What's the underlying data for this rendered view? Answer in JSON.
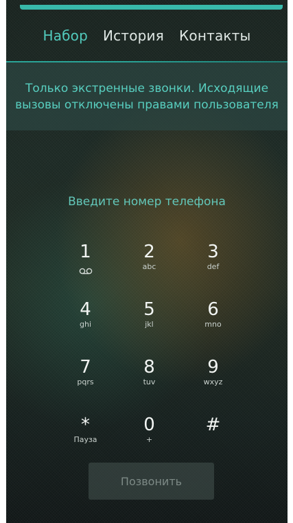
{
  "tabs": [
    {
      "label": "Набор",
      "active": true
    },
    {
      "label": "История",
      "active": false
    },
    {
      "label": "Контакты",
      "active": false
    }
  ],
  "notice": "Только экстренные звонки. Исходящие вызовы отключены правами пользователя",
  "prompt": "Введите номер телефона",
  "keys": [
    {
      "digit": "1",
      "letters": "",
      "icon": "voicemail-icon"
    },
    {
      "digit": "2",
      "letters": "abc"
    },
    {
      "digit": "3",
      "letters": "def"
    },
    {
      "digit": "4",
      "letters": "ghi"
    },
    {
      "digit": "5",
      "letters": "jkl"
    },
    {
      "digit": "6",
      "letters": "mno"
    },
    {
      "digit": "7",
      "letters": "pqrs"
    },
    {
      "digit": "8",
      "letters": "tuv"
    },
    {
      "digit": "9",
      "letters": "wxyz"
    },
    {
      "digit": "*",
      "letters": "Пауза"
    },
    {
      "digit": "0",
      "letters": "+"
    },
    {
      "digit": "#",
      "letters": ""
    }
  ],
  "call_button": "Позвонить",
  "colors": {
    "accent": "#52cbbd",
    "topbar": "#38b9aa"
  }
}
